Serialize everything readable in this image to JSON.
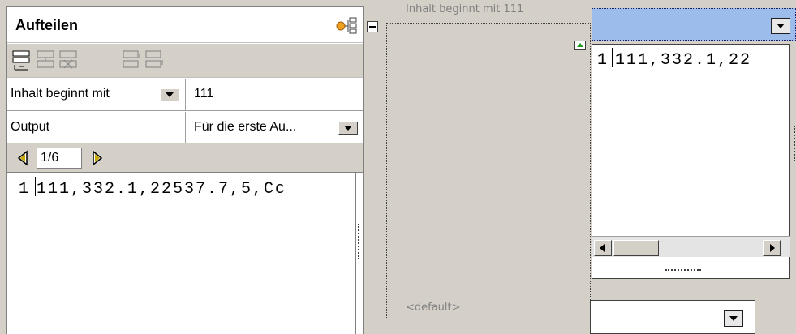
{
  "panel": {
    "title": "Aufteilen",
    "title_icon": "split-tree-icon",
    "toolbar": [
      {
        "icon": "insert-row-icon"
      },
      {
        "icon": "add-row-icon"
      },
      {
        "icon": "delete-row-icon"
      },
      {
        "icon": "move-up-icon"
      },
      {
        "icon": "move-down-icon"
      }
    ],
    "properties": [
      {
        "label": "Inhalt beginnt mit",
        "value": "111"
      },
      {
        "label": "Output",
        "value": "Für die erste Au..."
      }
    ],
    "pager": "1/6",
    "editor": {
      "line_number": "1",
      "text": "111,332.1,22537.7,5,Cc"
    }
  },
  "design": {
    "section_label": "Inhalt beginnt mit 111",
    "default_label": "<default>"
  },
  "preview": {
    "line_number": "1",
    "text": "111,332.1,22"
  },
  "colors": {
    "header_accent": "#9cbcec",
    "marker_green": "#1e9e1e",
    "nav_arrow": "#c8a800"
  }
}
